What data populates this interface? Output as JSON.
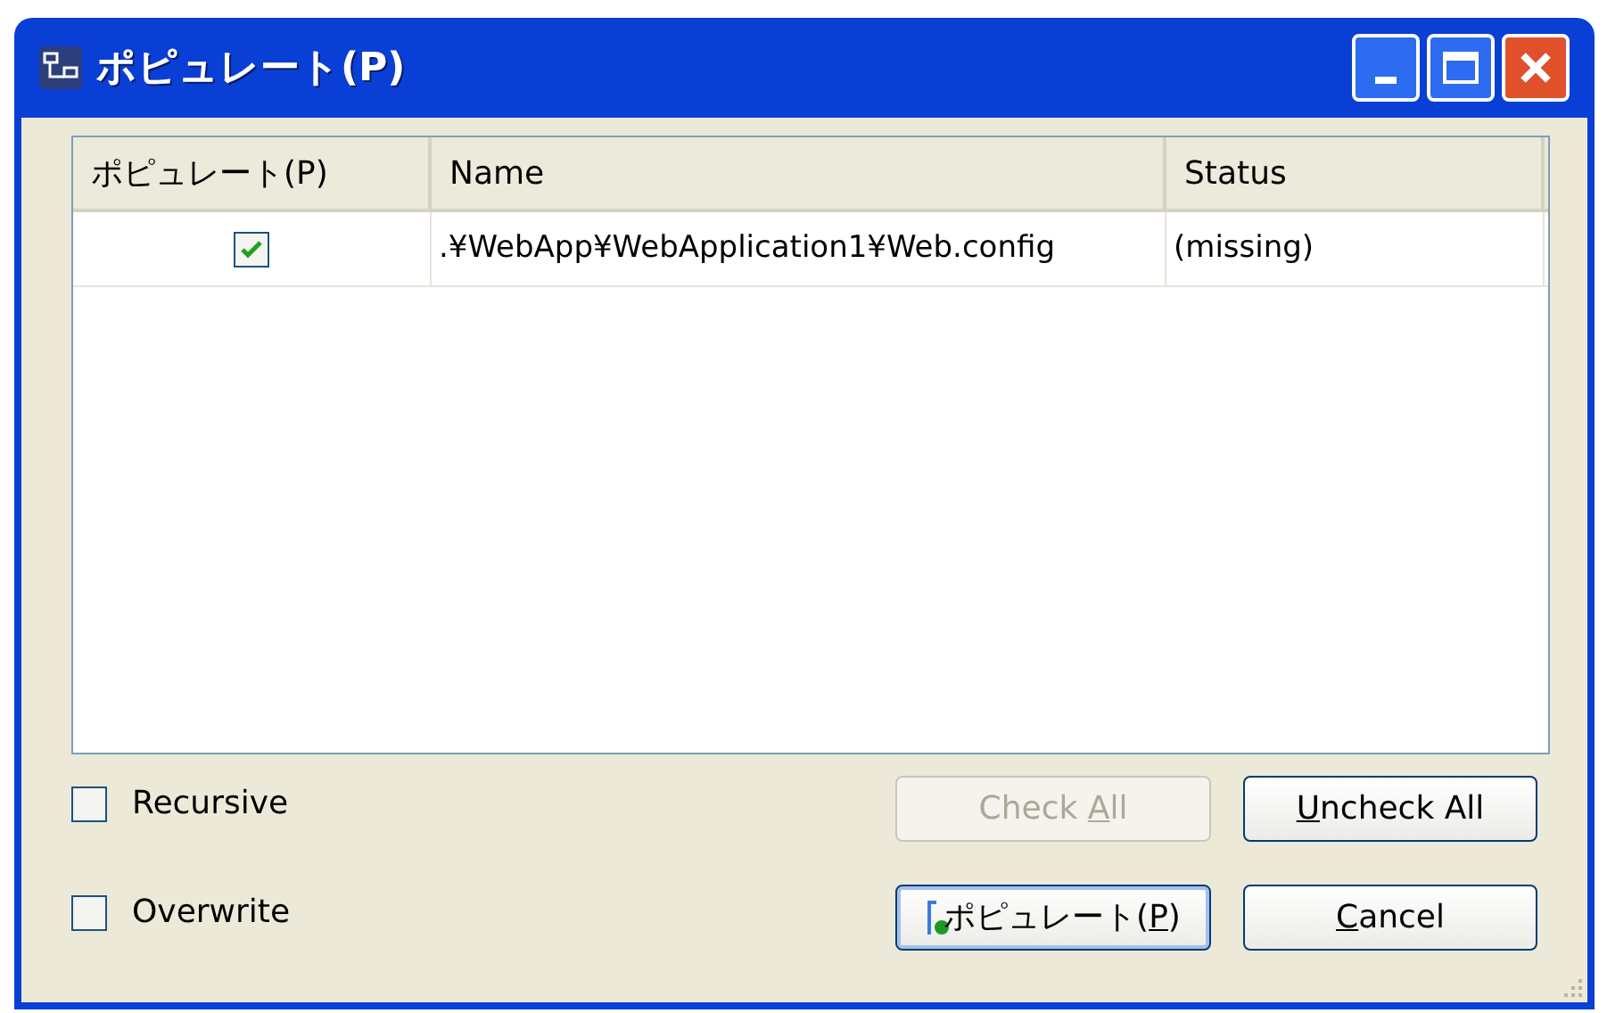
{
  "window": {
    "title": "ポピュレート(P)"
  },
  "table": {
    "columns": [
      "ポピュレート(P)",
      "Name",
      "Status"
    ],
    "rows": [
      {
        "checked": true,
        "name": ".¥WebApp¥WebApplication1¥Web.config",
        "status": "(missing)"
      }
    ]
  },
  "options": [
    {
      "label": "Recursive",
      "checked": false
    },
    {
      "label": "Overwrite",
      "checked": false
    }
  ],
  "buttons": [
    {
      "before": "Check ",
      "mnemonic": "A",
      "after": "ll",
      "disabled": true,
      "default": false,
      "icon": false
    },
    {
      "mnemonic": "U",
      "after": "ncheck All",
      "disabled": false,
      "default": false,
      "icon": false
    },
    {
      "before": "ポピュレート(",
      "mnemonic": "P",
      "after": ")",
      "disabled": false,
      "default": true,
      "icon": true
    },
    {
      "mnemonic": "C",
      "after": "ancel",
      "disabled": false,
      "default": false,
      "icon": false
    }
  ]
}
